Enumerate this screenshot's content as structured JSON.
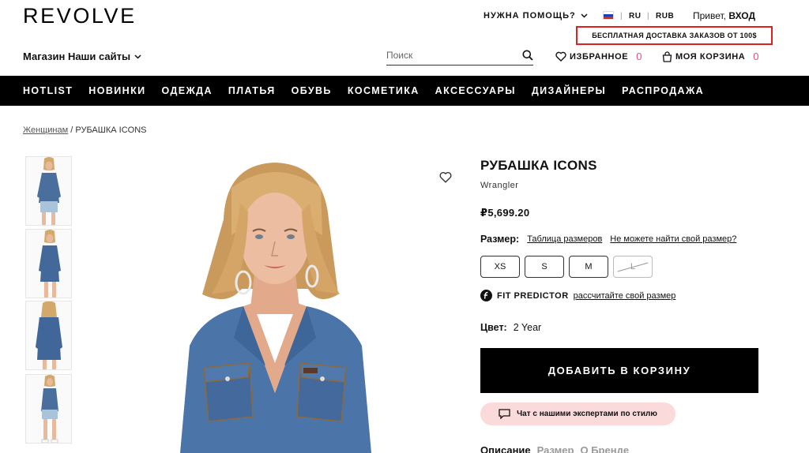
{
  "header": {
    "logo": "REVOLVE",
    "help": "НУЖНА ПОМОЩЬ?",
    "language": "RU",
    "currency": "RUB",
    "greeting": "Привет,",
    "login": "ВХОД",
    "promo": "БЕСПЛАТНАЯ ДОСТАВКА ЗАКАЗОВ ОТ 100$",
    "sites": "Магазин Наши сайты",
    "search_placeholder": "Поиск",
    "favorites_label": "ИЗБРАННОЕ",
    "favorites_count": "0",
    "cart_label": "МОЯ КОРЗИНА",
    "cart_count": "0",
    "accent_color": "#e84a7f"
  },
  "nav": {
    "items": [
      "HOTLIST",
      "НОВИНКИ",
      "ОДЕЖДА",
      "ПЛАТЬЯ",
      "ОБУВЬ",
      "КОСМЕТИКА",
      "АКСЕССУАРЫ",
      "ДИЗАЙНЕРЫ",
      "РАСПРОДАЖА"
    ]
  },
  "breadcrumb": {
    "parent": "Женщинам",
    "separator": "/",
    "current": "РУБАШКА ICONS"
  },
  "product": {
    "title": "РУБАШКА ICONS",
    "brand": "Wrangler",
    "price": "₽5,699.20",
    "size_label": "Размер:",
    "size_chart": "Таблица размеров",
    "size_help": "Не можете найти свой размер?",
    "sizes": [
      "XS",
      "S",
      "M",
      "L"
    ],
    "fit_predictor": "FIT PREDICTOR",
    "fit_link": "рассчитайте свой размер",
    "color_label": "Цвет:",
    "color_value": "2 Year",
    "add_to_cart": "ДОБАВИТЬ В КОРЗИНУ",
    "chat": "Чат с нашими экспертами по стилю",
    "tabs": [
      "Описание",
      "Размер",
      "О Бренде"
    ]
  }
}
